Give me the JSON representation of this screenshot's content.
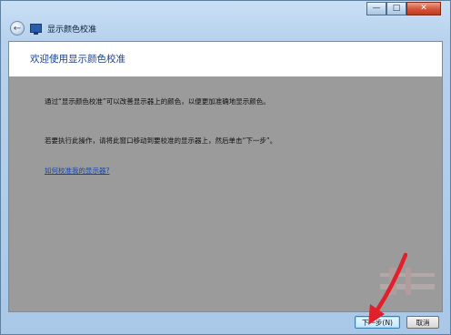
{
  "window": {
    "controls": {
      "minimize": "—",
      "maximize": "□",
      "close": "✕"
    }
  },
  "nav": {
    "back_icon": "back-arrow-icon",
    "back_glyph": "←",
    "app_icon": "display-monitor-icon",
    "title": "显示颜色校准"
  },
  "header": {
    "title": "欢迎使用显示颜色校准"
  },
  "body": {
    "paragraph1": "通过“显示颜色校准”可以改善显示器上的颜色，以便更加准确地显示颜色。",
    "paragraph2": "若要执行此操作，请将此窗口移动到要校准的显示器上，然后单击“下一步”。",
    "help_link": "如何校准我的显示器?"
  },
  "footer": {
    "next_label": "下一步(N)",
    "cancel_label": "取消"
  },
  "colors": {
    "dimmed_content": "#9b9b9b",
    "header_text": "#1a3f8a",
    "link": "#1648b0",
    "annotation_arrow": "#e0202a"
  }
}
